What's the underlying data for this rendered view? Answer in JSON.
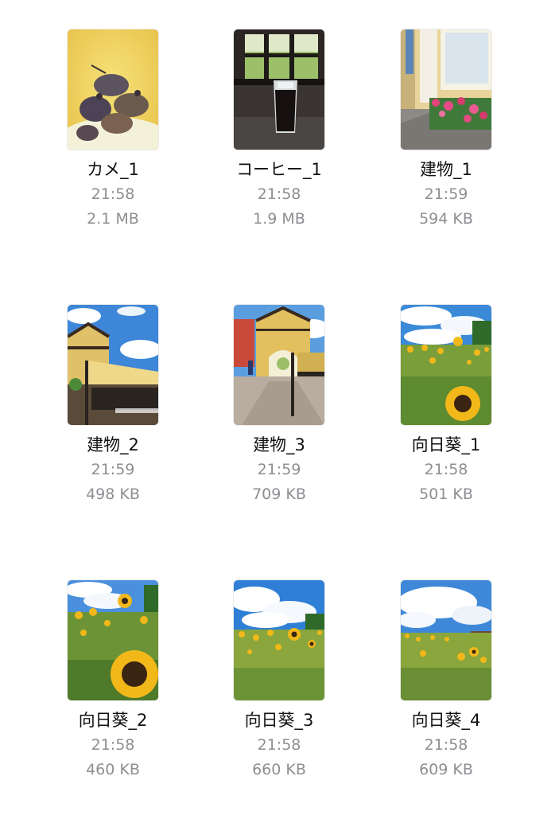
{
  "files": [
    {
      "name": "カメ_1",
      "time": "21:58",
      "size": "2.1 MB",
      "thumbnail": "turtles-photo"
    },
    {
      "name": "コーヒー_1",
      "time": "21:58",
      "size": "1.9 MB",
      "thumbnail": "iced-coffee-photo"
    },
    {
      "name": "建物_1",
      "time": "21:59",
      "size": "594 KB",
      "thumbnail": "building-flowers-photo"
    },
    {
      "name": "建物_2",
      "time": "21:59",
      "size": "498 KB",
      "thumbnail": "building-awning-photo"
    },
    {
      "name": "建物_3",
      "time": "21:59",
      "size": "709 KB",
      "thumbnail": "building-gate-photo"
    },
    {
      "name": "向日葵_1",
      "time": "21:58",
      "size": "501 KB",
      "thumbnail": "sunflower-field-photo"
    },
    {
      "name": "向日葵_2",
      "time": "21:58",
      "size": "460 KB",
      "thumbnail": "sunflower-closeup-photo"
    },
    {
      "name": "向日葵_3",
      "time": "21:58",
      "size": "660 KB",
      "thumbnail": "sunflower-sky-photo"
    },
    {
      "name": "向日葵_4",
      "time": "21:58",
      "size": "609 KB",
      "thumbnail": "sunflower-clouds-photo"
    }
  ]
}
